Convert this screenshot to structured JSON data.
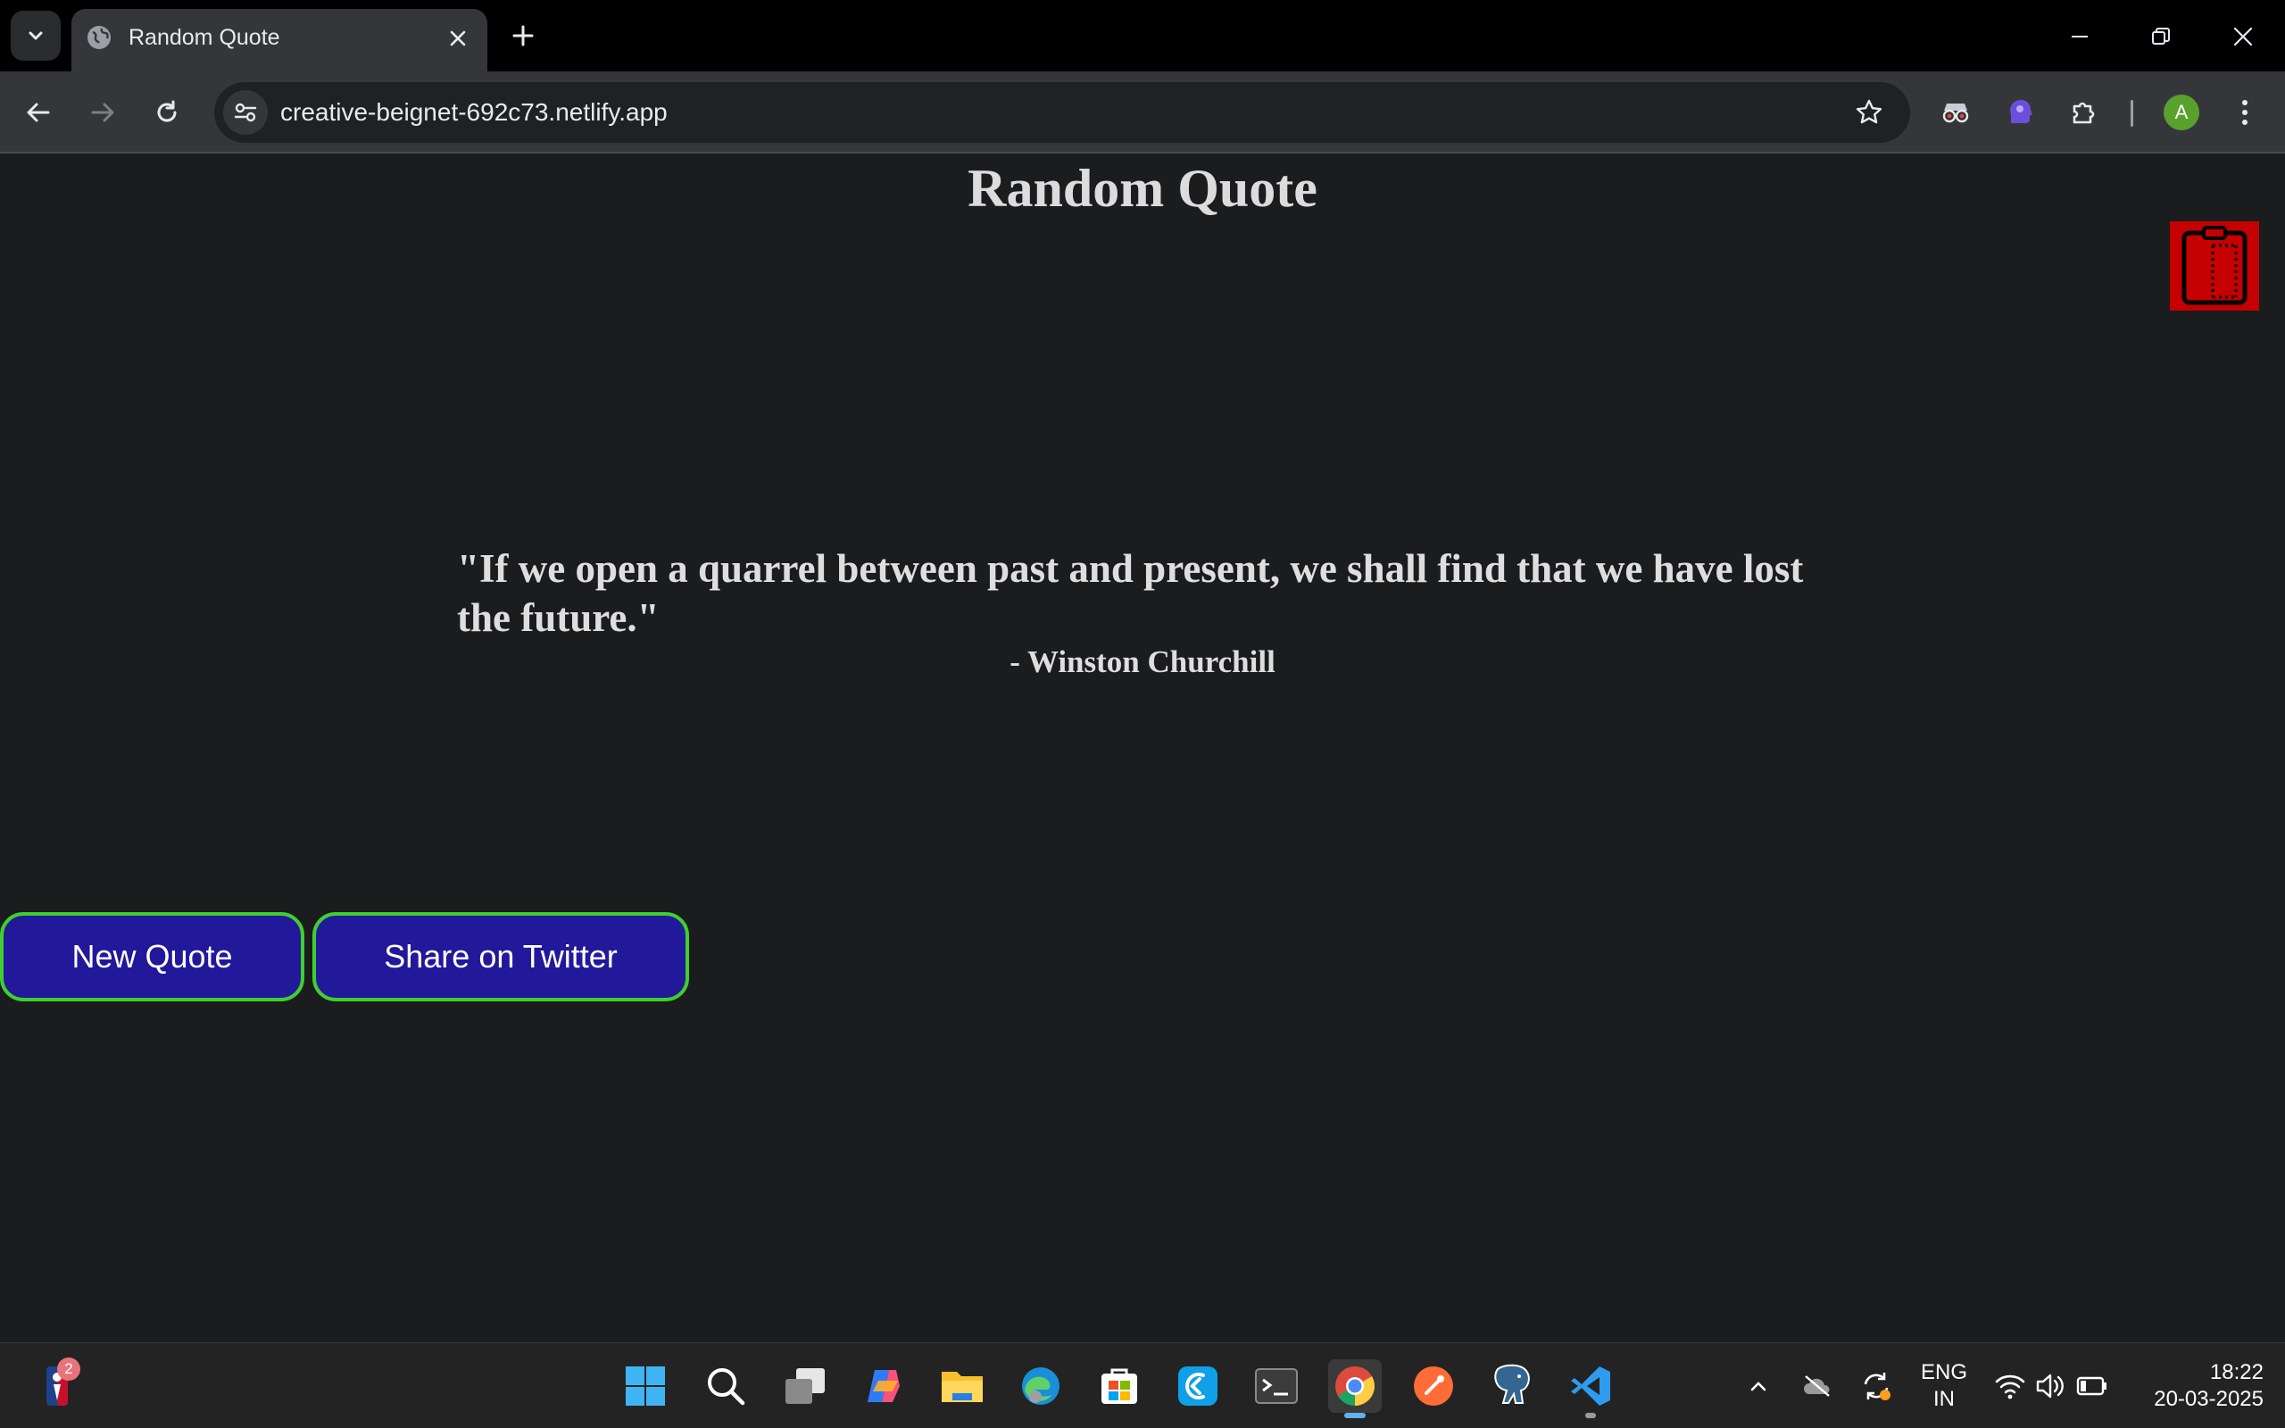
{
  "browser": {
    "tab": {
      "title": "Random Quote"
    },
    "url": "creative-beignet-692c73.netlify.app",
    "profile_initial": "A"
  },
  "page": {
    "title": "Random Quote",
    "quote": "\"If we open a quarrel between past and present, we shall find that we have lost the future.\"",
    "author": "- Winston Churchill",
    "buttons": {
      "new_quote": "New Quote",
      "share_twitter": "Share on Twitter"
    }
  },
  "taskbar": {
    "notification_count": "2",
    "language": [
      "ENG",
      "IN"
    ],
    "time": "18:22",
    "date": "20-03-2025"
  },
  "colors": {
    "page_bg": "#1b1c1e",
    "button_bg": "#22189a",
    "button_border": "#3fcf2f",
    "clipboard_widget": "#c40000"
  }
}
